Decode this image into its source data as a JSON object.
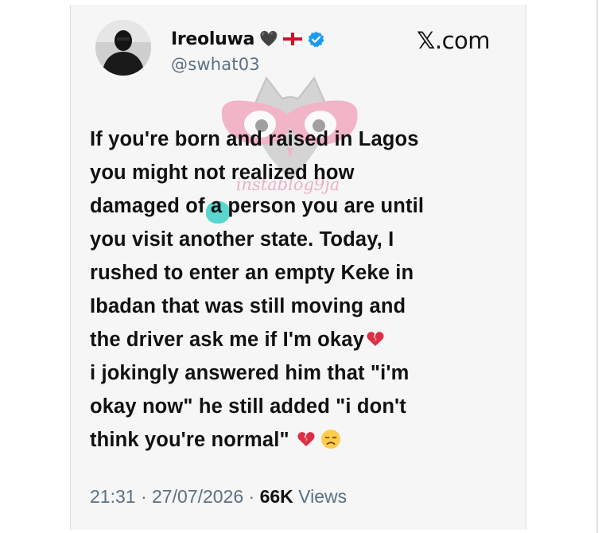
{
  "user": {
    "display_name": "Ireoluwa",
    "handle": "@swhat03",
    "verified": true,
    "name_emojis": [
      "black-heart-icon",
      "england-flag-icon"
    ]
  },
  "brand": {
    "x_letter": "𝕏",
    "suffix": ".com"
  },
  "watermark": {
    "text": "instablog9ja"
  },
  "tweet": {
    "lines": [
      "If you're born and raised in Lagos",
      "you might not realized how",
      "damaged of a person you are until",
      "you visit another state. Today, I",
      "rushed to enter an empty Keke in",
      "Ibadan that was still moving and",
      "the driver ask me if I'm okay",
      "i jokingly answered him that \"i'm",
      "okay now\" he still added \"i don't",
      "think you're normal\""
    ],
    "emojis": [
      "broken-heart-icon",
      "broken-heart-icon",
      "disappointed-face-icon"
    ]
  },
  "meta": {
    "time": "21:31",
    "separator": " · ",
    "date": "27/07/2026",
    "views_count": "66K",
    "views_label": " Views"
  },
  "colors": {
    "background": "#ffffff",
    "card": "#f6f6f6",
    "text": "#111111",
    "secondary_text": "#5b7083",
    "verified_blue": "#1d9bf0",
    "broken_heart": "#dd2e44",
    "watermark_pink": "#e27a98",
    "smudge_teal": "#5ad6d1"
  }
}
